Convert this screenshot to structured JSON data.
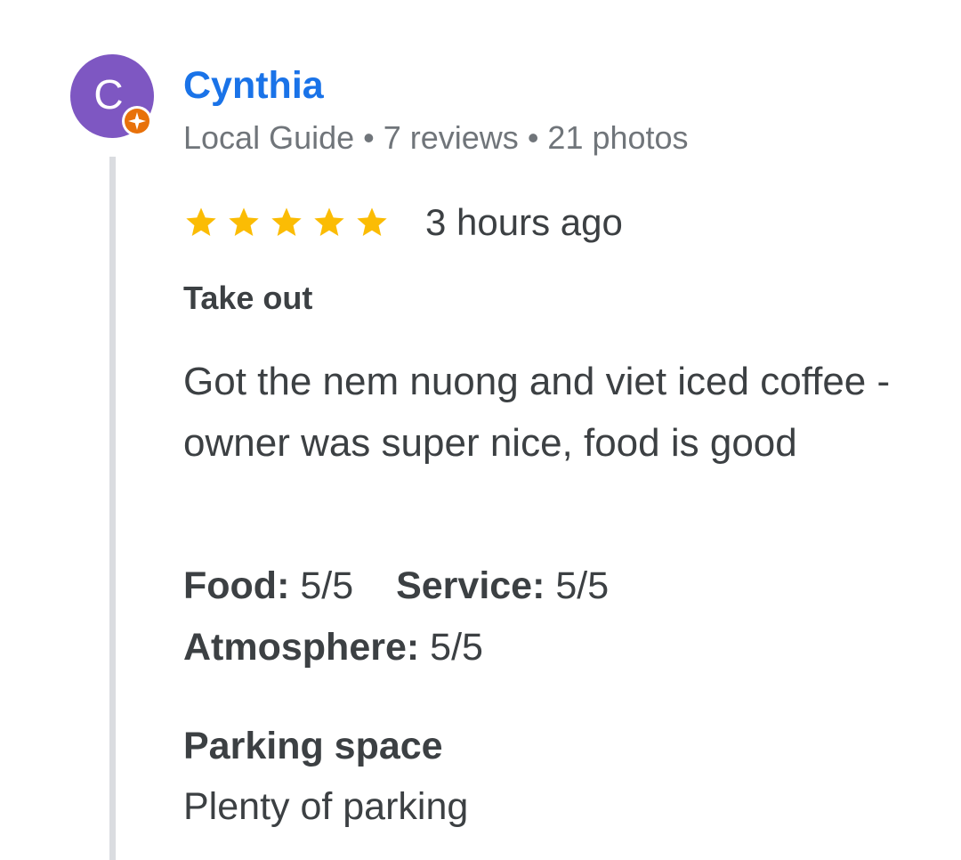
{
  "review": {
    "author": {
      "initial": "C",
      "name": "Cynthia",
      "avatar_color": "#7e57c2",
      "badge_icon": "local-guide-badge-icon",
      "badge_color": "#e8710a",
      "meta_parts": [
        "Local Guide",
        "7 reviews",
        "21 photos"
      ],
      "meta_separator": "•"
    },
    "rating": {
      "stars": 5,
      "max_stars": 5,
      "star_color": "#fbbc04",
      "star_icon": "star-icon"
    },
    "time_ago": "3 hours ago",
    "service_type": "Take out",
    "text": "Got the nem nuong and viet iced coffee - owner was super nice, food is good",
    "ratings_breakdown": [
      {
        "label": "Food:",
        "value": "5/5"
      },
      {
        "label": "Service:",
        "value": "5/5"
      },
      {
        "label": "Atmosphere:",
        "value": "5/5"
      }
    ],
    "details": [
      {
        "title": "Parking space",
        "value": "Plenty of parking"
      }
    ],
    "colors": {
      "name": "#1a73e8",
      "meta": "#70757a",
      "body": "#3c4043",
      "thread_line": "#dadce0"
    }
  }
}
